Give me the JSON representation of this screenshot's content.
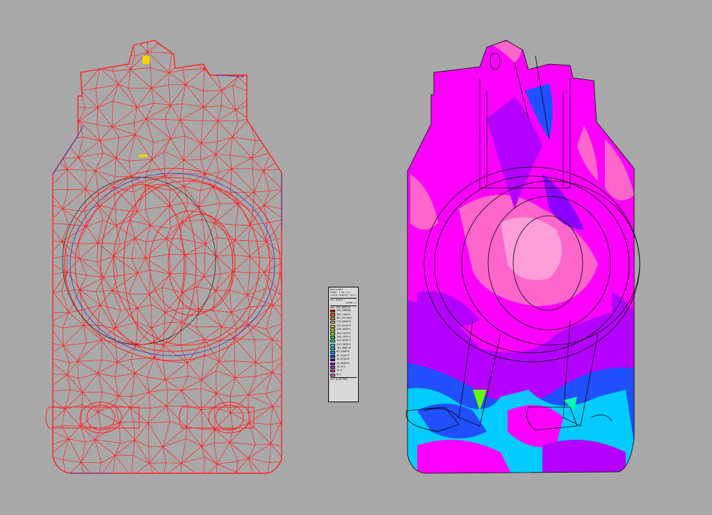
{
  "legend": {
    "title_lines": [
      "Nonlinear",
      "Step: 1.0E-(1)",
      "Yield Points: 879,78",
      "Von Mises",
      "(N/mm^2)"
    ],
    "max_label": "max 373,4691*8",
    "min_label": "min 6,64*303",
    "levels": [
      {
        "value": "349,288488",
        "color": "#ff0000"
      },
      {
        "value": "325,1103*8",
        "color": "#ff5a00"
      },
      {
        "value": "301,0271897",
        "color": "#ff9600"
      },
      {
        "value": "276,8495*6",
        "color": "#ffcc00"
      },
      {
        "value": "252,6719*5",
        "color": "#ffff00"
      },
      {
        "value": "228,4943*4",
        "color": "#c8ff00"
      },
      {
        "value": "204,3167*3",
        "color": "#64ff00"
      },
      {
        "value": "180,1391*2",
        "color": "#00ff3c"
      },
      {
        "value": "155,9615*1",
        "color": "#00ffaa"
      },
      {
        "value": "131,7839*0",
        "color": "#00ffff"
      },
      {
        "value": "107,6062*9",
        "color": "#00c8ff"
      },
      {
        "value": "83,4286*8",
        "color": "#0096ff"
      },
      {
        "value": "59,2510*7",
        "color": "#0050ff"
      },
      {
        "value": "35,0734*6",
        "color": "#3c00ff"
      },
      {
        "value": "23,9846*5",
        "color": "#8c00ff"
      },
      {
        "value": "18,4*4",
        "color": "#c800ff"
      },
      {
        "value": "12,9",
        "color": "#ff00ff"
      },
      {
        "value": "8,5",
        "color": "#ff64c8"
      }
    ]
  },
  "colors": {
    "background": "#a8a8a8",
    "mesh": "#ff2020",
    "mesh_blue": "#3030d0",
    "outline": "#000000",
    "magenta": "#ff00ff",
    "pink": "#ff66cc",
    "violet": "#b400ff",
    "blue": "#2050ff",
    "cyan": "#00d8ff"
  }
}
